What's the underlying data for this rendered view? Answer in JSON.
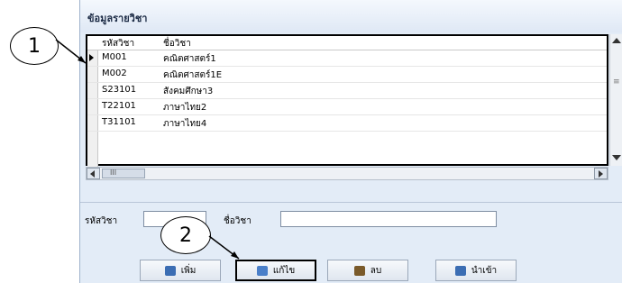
{
  "window": {
    "title": "ข้อมูลรายวิชา"
  },
  "grid": {
    "columns": [
      "รหัสวิชา",
      "ชื่อวิชา"
    ],
    "rows": [
      {
        "code": "M001",
        "name": "คณิตศาสตร์1",
        "selected": true
      },
      {
        "code": "M002",
        "name": "คณิตศาสตร์1E"
      },
      {
        "code": "S23101",
        "name": "สังคมศึกษา3"
      },
      {
        "code": "T22101",
        "name": "ภาษาไทย2"
      },
      {
        "code": "T31101",
        "name": "ภาษาไทย4"
      }
    ]
  },
  "scrollbar": {
    "thumb_label": "III"
  },
  "form": {
    "code_label": "รหัสวิชา",
    "code_value": "",
    "name_label": "ชื่อวิชา",
    "name_value": ""
  },
  "buttons": [
    {
      "label": "เพิ่ม",
      "icon": "add-icon",
      "color": "#3b6db3"
    },
    {
      "label": "แก้ไข",
      "icon": "edit-icon",
      "color": "#4a7fc9"
    },
    {
      "label": "ลบ",
      "icon": "delete-icon",
      "color": "#7a5a2a"
    },
    {
      "label": "นำเข้า",
      "icon": "import-icon",
      "color": "#3b6db3"
    }
  ],
  "callouts": [
    "1",
    "2"
  ]
}
